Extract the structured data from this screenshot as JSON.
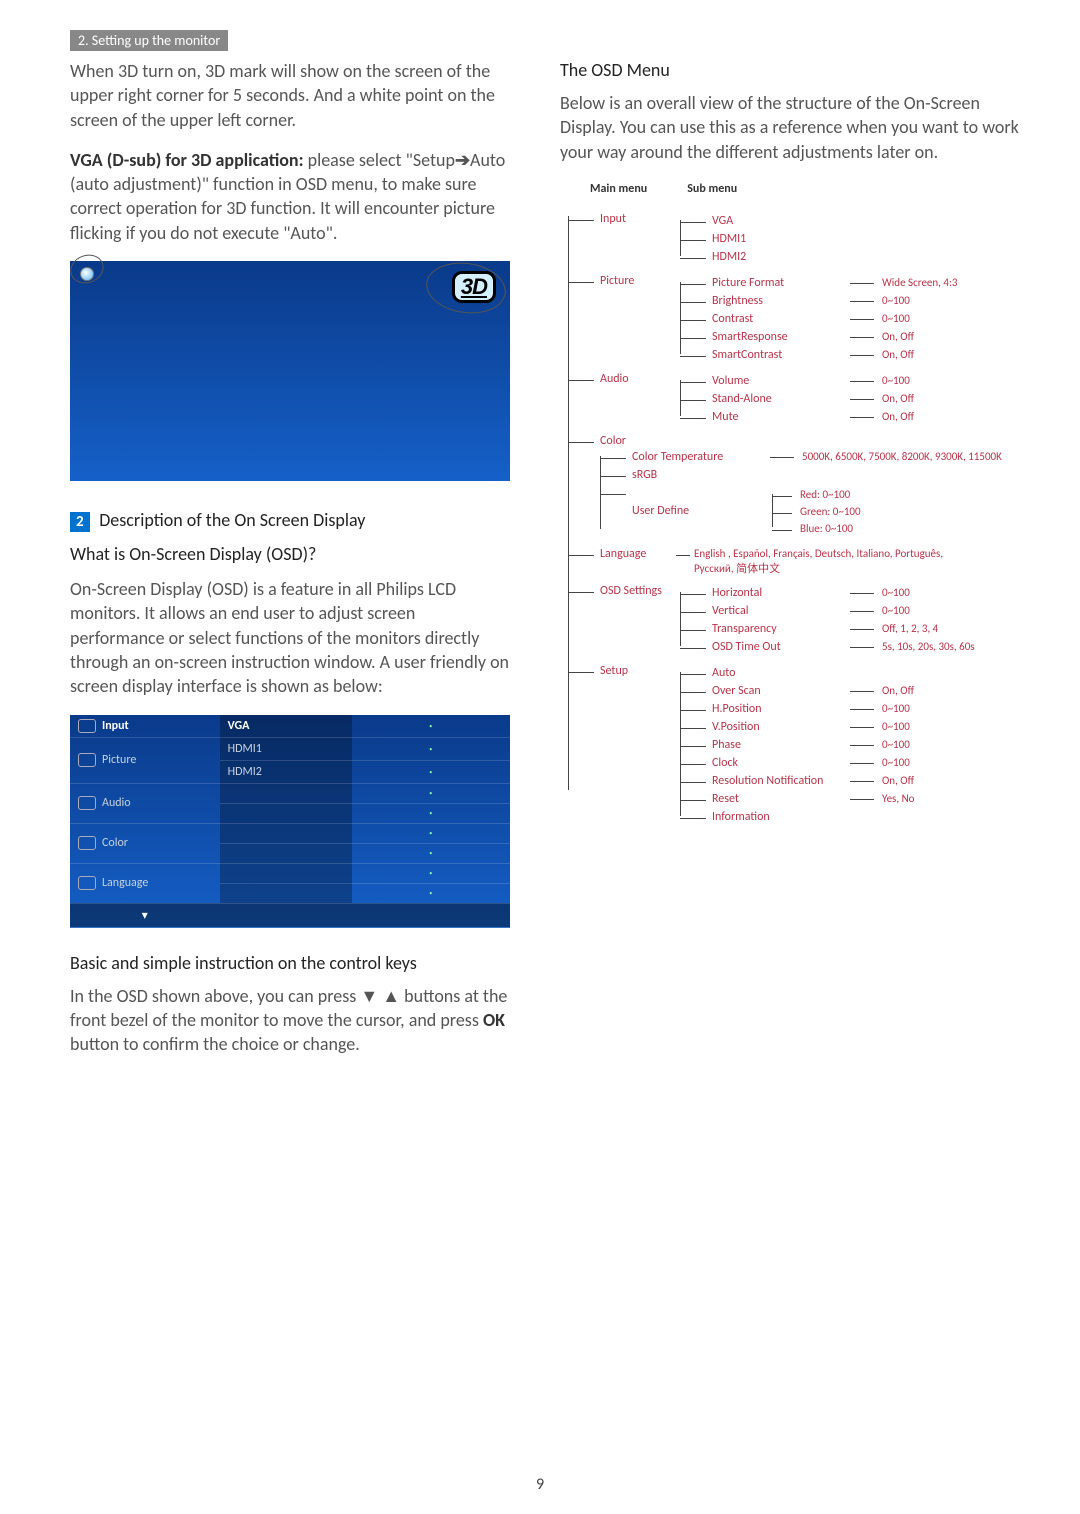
{
  "section_tag": "2. Setting up the monitor",
  "left": {
    "p1": "When 3D turn on, 3D mark will show on the screen of the upper right corner for 5 seconds. And a white point on the screen of the upper left corner.",
    "p2_bold": "VGA (D-sub) for 3D application:",
    "p2_rest": " please select \"Setup",
    "p2_arrow": "➔",
    "p2_rest2": "Auto (auto adjustment)\" function in OSD menu, to make sure correct operation for 3D function. It will encounter picture flicking if you do not execute \"Auto\".",
    "mark3d": "3D",
    "num2": "2",
    "h2_title": "Description of the On Screen Display",
    "h3_q": "What is On-Screen Display (OSD)?",
    "p3": "On-Screen Display (OSD) is a feature in all Philips LCD monitors. It allows an end user to adjust screen performance or select functions of the monitors directly through an on-screen instruction window. A user friendly on screen display interface is shown as below:",
    "osd_menu": [
      "Input",
      "Picture",
      "Audio",
      "Color",
      "Language"
    ],
    "osd_sub": [
      "VGA",
      "HDMI1",
      "HDMI2"
    ],
    "h4": "Basic and simple instruction on the control keys",
    "p4a": "In the OSD shown above, you can press ",
    "p4_down": "▼",
    "p4_up": "▲",
    "p4b": " buttons at the front bezel of the monitor to move the cursor, and press ",
    "p4_ok": "OK",
    "p4c": " button to confirm the choice or change."
  },
  "right": {
    "h1": "The OSD Menu",
    "p1": "Below is an overall view of the structure of the On-Screen Display. You can use this as a reference when you want to work your way around the different adjustments later on.",
    "header_main": "Main menu",
    "header_sub": "Sub menu",
    "tree": [
      {
        "label": "Input",
        "items": [
          {
            "s": "VGA"
          },
          {
            "s": "HDMI1"
          },
          {
            "s": "HDMI2"
          }
        ]
      },
      {
        "label": "Picture",
        "items": [
          {
            "s": "Picture Format",
            "v": "Wide Screen, 4:3"
          },
          {
            "s": "Brightness",
            "v": "0~100"
          },
          {
            "s": "Contrast",
            "v": "0~100"
          },
          {
            "s": "SmartResponse",
            "v": "On, Off"
          },
          {
            "s": "SmartContrast",
            "v": "On, Off"
          }
        ]
      },
      {
        "label": "Audio",
        "items": [
          {
            "s": "Volume",
            "v": "0~100"
          },
          {
            "s": "Stand-Alone",
            "v": "On, Off"
          },
          {
            "s": "Mute",
            "v": "On, Off"
          }
        ]
      },
      {
        "label": "Color",
        "items": [
          {
            "s": "Color Temperature",
            "v": "5000K, 6500K, 7500K, 8200K, 9300K, 11500K"
          },
          {
            "s": "sRGB"
          },
          {
            "s": "User Define",
            "nested": [
              "Red: 0~100",
              "Green: 0~100",
              "Blue: 0~100"
            ]
          }
        ]
      },
      {
        "label": "Language",
        "lang": "English , Español, Français, Deutsch, Italiano, Português, Русский, 简体中文"
      },
      {
        "label": "OSD Settings",
        "items": [
          {
            "s": "Horizontal",
            "v": "0~100"
          },
          {
            "s": "Vertical",
            "v": "0~100"
          },
          {
            "s": "Transparency",
            "v": "Off, 1, 2, 3, 4"
          },
          {
            "s": "OSD Time Out",
            "v": "5s, 10s, 20s, 30s, 60s"
          }
        ]
      },
      {
        "label": "Setup",
        "items": [
          {
            "s": "Auto"
          },
          {
            "s": "Over Scan",
            "v": "On, Off"
          },
          {
            "s": "H.Position",
            "v": "0~100"
          },
          {
            "s": "V.Position",
            "v": "0~100"
          },
          {
            "s": "Phase",
            "v": "0~100"
          },
          {
            "s": "Clock",
            "v": "0~100"
          },
          {
            "s": "Resolution Notification",
            "v": "On, Off"
          },
          {
            "s": "Reset",
            "v": "Yes, No"
          },
          {
            "s": "Information"
          }
        ]
      }
    ]
  },
  "page_number": "9"
}
